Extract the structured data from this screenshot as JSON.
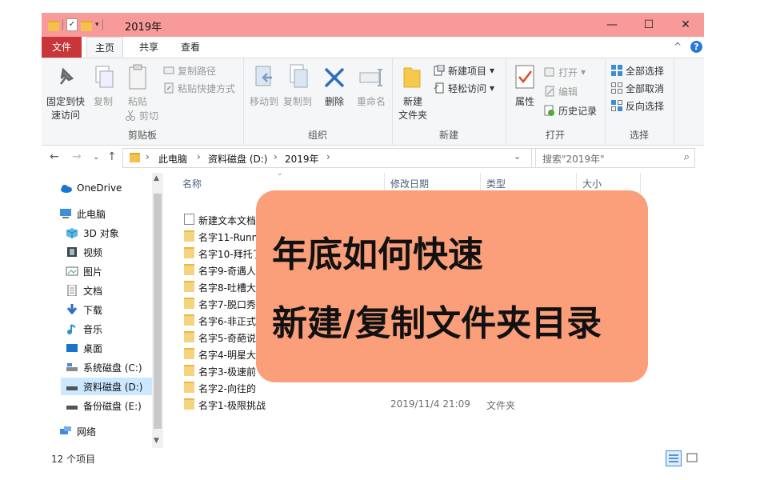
{
  "window": {
    "title": "2019年",
    "controls": {
      "minimize": "—",
      "maximize": "☐",
      "close": "✕"
    }
  },
  "tabs": {
    "file": "文件",
    "home": "主页",
    "share": "共享",
    "view": "查看",
    "collapse": "^",
    "help": "?"
  },
  "ribbon": {
    "clipboard": {
      "label": "剪贴板",
      "pin_line1": "固定到快",
      "pin_line2": "速访问",
      "copy": "复制",
      "paste": "粘贴",
      "copy_path": "复制路径",
      "paste_shortcut": "粘贴快捷方式",
      "cut": "剪切"
    },
    "organize": {
      "label": "组织",
      "move_to": "移动到",
      "copy_to": "复制到",
      "delete": "删除",
      "rename": "重命名"
    },
    "new": {
      "label": "新建",
      "new_folder_line1": "新建",
      "new_folder_line2": "文件夹",
      "new_item": "新建项目",
      "easy_access": "轻松访问"
    },
    "open": {
      "label": "打开",
      "properties": "属性",
      "open": "打开",
      "edit": "编辑",
      "history": "历史记录"
    },
    "select": {
      "label": "选择",
      "select_all": "全部选择",
      "select_none": "全部取消",
      "invert": "反向选择"
    }
  },
  "address": {
    "breadcrumbs": [
      "此电脑",
      "资料磁盘 (D:)",
      "2019年"
    ],
    "search_placeholder": "搜索\"2019年\""
  },
  "nav": {
    "items": [
      {
        "label": "OneDrive",
        "icon": "cloud-icon"
      },
      {
        "label": "此电脑",
        "icon": "computer-icon"
      },
      {
        "label": "3D 对象",
        "icon": "cube-icon"
      },
      {
        "label": "视频",
        "icon": "film-icon"
      },
      {
        "label": "图片",
        "icon": "picture-icon"
      },
      {
        "label": "文档",
        "icon": "document-icon"
      },
      {
        "label": "下载",
        "icon": "download-icon"
      },
      {
        "label": "音乐",
        "icon": "music-icon"
      },
      {
        "label": "桌面",
        "icon": "desktop-icon"
      },
      {
        "label": "系统磁盘 (C:)",
        "icon": "drive-icon"
      },
      {
        "label": "资料磁盘 (D:)",
        "icon": "drive-icon",
        "selected": true
      },
      {
        "label": "备份磁盘 (E:)",
        "icon": "drive-icon"
      },
      {
        "label": "网络",
        "icon": "network-icon"
      }
    ]
  },
  "columns": {
    "name": "名称",
    "modified": "修改日期",
    "type": "类型",
    "size": "大小"
  },
  "files": [
    {
      "name": "新建文本文档",
      "date": "",
      "type": "",
      "kind": "text"
    },
    {
      "name": "名字11-Runn",
      "date": "",
      "type": "",
      "kind": "folder"
    },
    {
      "name": "名字10-拜托了",
      "date": "",
      "type": "",
      "kind": "folder"
    },
    {
      "name": "名字9-奇遇人",
      "date": "",
      "type": "",
      "kind": "folder"
    },
    {
      "name": "名字8-吐槽大",
      "date": "",
      "type": "",
      "kind": "folder"
    },
    {
      "name": "名字7-脱口秀",
      "date": "",
      "type": "",
      "kind": "folder"
    },
    {
      "name": "名字6-非正式",
      "date": "",
      "type": "",
      "kind": "folder"
    },
    {
      "name": "名字5-奇葩说",
      "date": "",
      "type": "",
      "kind": "folder"
    },
    {
      "name": "名字4-明星大",
      "date": "",
      "type": "",
      "kind": "folder"
    },
    {
      "name": "名字3-极速前",
      "date": "",
      "type": "",
      "kind": "folder"
    },
    {
      "name": "名字2-向往的",
      "date": "",
      "type": "",
      "kind": "folder"
    },
    {
      "name": "名字1-极限挑战",
      "date": "2019/11/4 21:09",
      "type": "文件夹",
      "kind": "folder"
    }
  ],
  "status": {
    "count": "12 个项目"
  },
  "overlay": {
    "line1": "年底如何快速",
    "line2": "新建/复制文件夹目录",
    "color": "#fb9e7a"
  },
  "colors": {
    "titlebar": "#f99a9a",
    "file_tab": "#c9363a",
    "selection": "#cce8ff"
  }
}
